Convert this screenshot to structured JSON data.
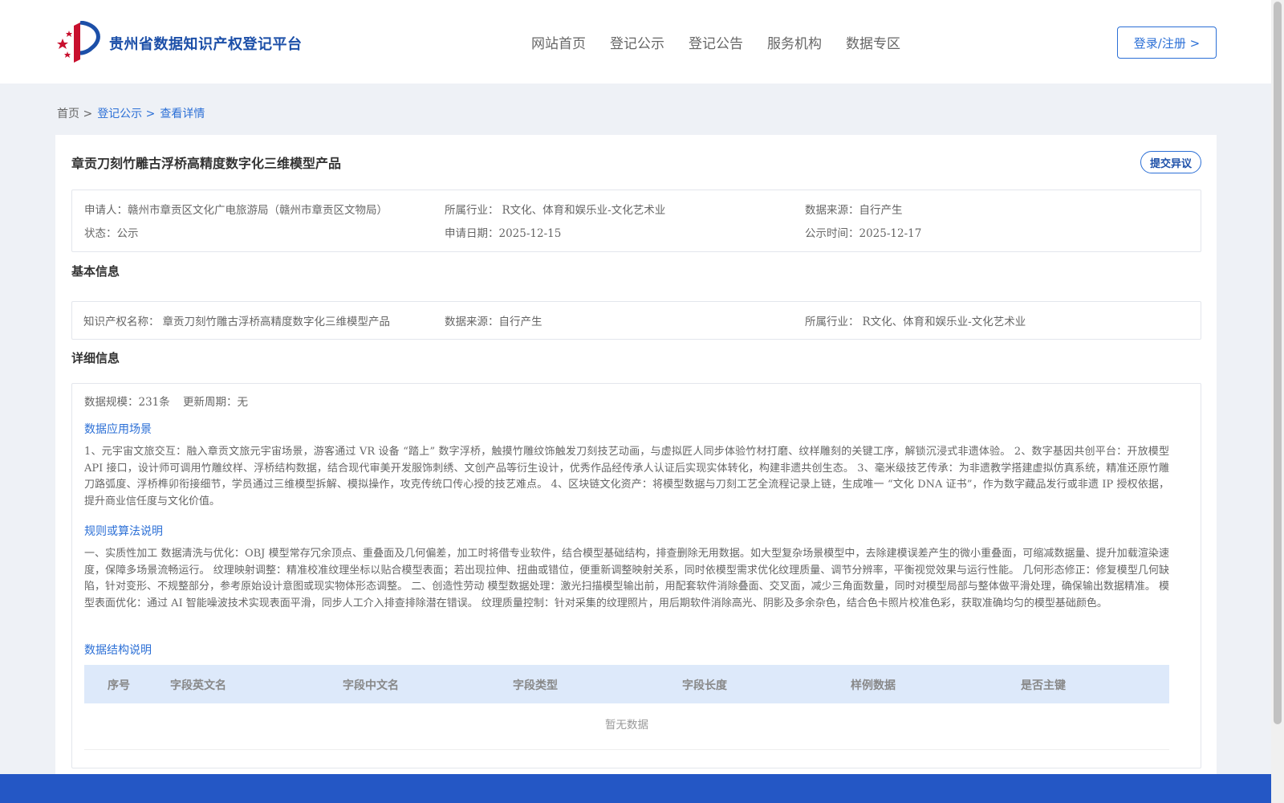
{
  "header": {
    "site_title": "贵州省数据知识产权登记平台",
    "nav": [
      "网站首页",
      "登记公示",
      "登记公告",
      "服务机构",
      "数据专区"
    ],
    "login_label": "登录/注册 >"
  },
  "breadcrumb": {
    "home": "首页 >",
    "publicity": "登记公示 >",
    "current": "查看详情"
  },
  "detail": {
    "title": "章贡刀刻竹雕古浮桥高精度数字化三维模型产品",
    "objection_label": "提交异议",
    "summary": {
      "applicant_label": "申请人：",
      "applicant": "赣州市章贡区文化广电旅游局（赣州市章贡区文物局）",
      "industry_label": "所属行业：",
      "industry": "R文化、体育和娱乐业-文化艺术业",
      "source_label": "数据来源：",
      "source": "自行产生",
      "status_label": "状态：",
      "status": "公示",
      "apply_date_label": "申请日期：",
      "apply_date": "2025-12-15",
      "publish_date_label": "公示时间：",
      "publish_date": "2025-12-17"
    },
    "basic_info": {
      "section_title": "基本信息",
      "ip_name_label": "知识产权名称：",
      "ip_name": "章贡刀刻竹雕古浮桥高精度数字化三维模型产品",
      "source_label": "数据来源：",
      "source": "自行产生",
      "industry_label": "所属行业：",
      "industry": "R文化、体育和娱乐业-文化艺术业"
    },
    "detail_info": {
      "section_title": "详细信息",
      "scale_label": "数据规模：",
      "scale": "231条",
      "cycle_label": "更新周期：",
      "cycle": "无",
      "scenario_title": "数据应用场景",
      "scenario_text": "1、元宇宙文旅交互：融入章贡文旅元宇宙场景，游客通过 VR 设备 “踏上” 数字浮桥，触摸竹雕纹饰触发刀刻技艺动画，与虚拟匠人同步体验竹材打磨、纹样雕刻的关键工序，解锁沉浸式非遗体验。 2、数字基因共创平台：开放模型 API 接口，设计师可调用竹雕纹样、浮桥结构数据，结合现代审美开发服饰刺绣、文创产品等衍生设计，优秀作品经传承人认证后实现实体转化，构建非遗共创生态。 3、毫米级技艺传承：为非遗教学搭建虚拟仿真系统，精准还原竹雕刀路弧度、浮桥榫卯衔接细节，学员通过三维模型拆解、模拟操作，攻克传统口传心授的技艺难点。 4、区块链文化资产：将模型数据与刀刻工艺全流程记录上链，生成唯一 “文化 DNA 证书”，作为数字藏品发行或非遗 IP 授权依据，提升商业信任度与文化价值。",
      "rules_title": "规则或算法说明",
      "rules_text": "一、实质性加工 数据清洗与优化：OBJ 模型常存冗余顶点、重叠面及几何偏差，加工时将借专业软件，结合模型基础结构，排查删除无用数据。如大型复杂场景模型中，去除建模误差产生的微小重叠面，可缩减数据量、提升加载渲染速度，保障多场景流畅运行。 纹理映射调整：精准校准纹理坐标以贴合模型表面；若出现拉伸、扭曲或错位，便重新调整映射关系，同时依模型需求优化纹理质量、调节分辨率，平衡视觉效果与运行性能。 几何形态修正：修复模型几何缺陷，针对变形、不规整部分，参考原始设计意图或现实物体形态调整。 二、创造性劳动 模型数据处理：激光扫描模型输出前，用配套软件消除叠面、交叉面，减少三角面数量，同时对模型局部与整体做平滑处理，确保输出数据精准。 模型表面优化：通过 AI 智能噪波技术实现表面平滑，同步人工介入排查排除潜在错误。 纹理质量控制：针对采集的纹理照片，用后期软件消除高光、阴影及多余杂色，结合色卡照片校准色彩，获取准确均匀的模型基础颜色。",
      "structure_title": "数据结构说明",
      "table_headers": [
        "序号",
        "字段英文名",
        "字段中文名",
        "字段类型",
        "字段长度",
        "样例数据",
        "是否主键"
      ],
      "empty_text": "暂无数据"
    }
  },
  "colors": {
    "brand_blue": "#2b6fd6",
    "title_blue": "#1c4fa8",
    "footer_blue": "#2457c5",
    "table_head_bg": "#dde9fa",
    "page_bg": "#eef1f6"
  }
}
